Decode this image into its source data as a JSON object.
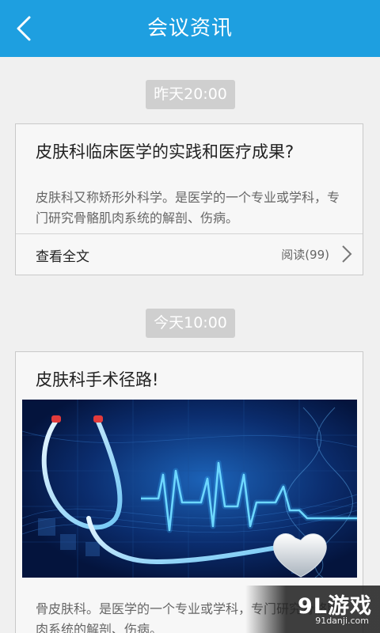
{
  "header": {
    "title": "会议资讯"
  },
  "feed": [
    {
      "time": "昨天20:00",
      "title": "皮肤科临床医学的实践和医疗成果?",
      "summary": "皮肤科又称矫形外科学。是医学的一个专业或学科，专门研究骨骼肌肉系统的解剖、伤病。",
      "more_label": "查看全文",
      "read_label": "阅读(99)"
    },
    {
      "time": "今天10:00",
      "title": "皮肤科手术径路!",
      "summary": "骨皮肤科。是医学的一个专业或学科，专门研究骨骼肌肉系统的解剖、伤病。",
      "image_icon": "stethoscope-heartbeat-illustration"
    }
  ],
  "watermark": {
    "logo": "9L游戏",
    "url": "91danji.com"
  },
  "colors": {
    "header": "#1e9fe0",
    "badge": "#cfcfcf",
    "card": "#f7f7f7",
    "background": "#f0f0f0"
  }
}
